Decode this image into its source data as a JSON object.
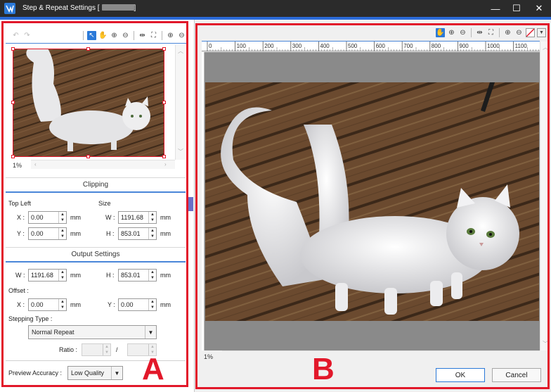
{
  "window": {
    "title": "Step & Repeat Settings",
    "title_suffix_open": " [",
    "title_suffix_close": "]",
    "minimize": "—",
    "maximize": "☐",
    "close": "✕"
  },
  "left_toolbar": {
    "icons": [
      "undo-icon",
      "redo-icon",
      "select-arrow-icon",
      "hand-icon",
      "zoom-in-icon",
      "zoom-out-icon",
      "fit-width-icon",
      "fit-page-icon",
      "plus-circle-icon",
      "minus-circle-icon"
    ]
  },
  "thumbnail": {
    "zoom": "1%"
  },
  "clipping": {
    "header": "Clipping",
    "top_left_label": "Top Left",
    "size_label": "Size",
    "x_label": "X :",
    "x_value": "0.00",
    "y_label": "Y :",
    "y_value": "0.00",
    "w_label": "W :",
    "w_value": "1191.68",
    "h_label": "H :",
    "h_value": "853.01",
    "unit": "mm"
  },
  "output": {
    "header": "Output Settings",
    "w_label": "W :",
    "w_value": "1191.68",
    "h_label": "H :",
    "h_value": "853.01",
    "unit": "mm",
    "offset_label": "Offset :",
    "offset_x_label": "X :",
    "offset_x_value": "0.00",
    "offset_y_label": "Y :",
    "offset_y_value": "0.00",
    "stepping_label": "Stepping Type :",
    "stepping_value": "Normal Repeat",
    "ratio_label": "Ratio :",
    "ratio_sep": "/"
  },
  "preview": {
    "accuracy_label": "Preview Accuracy :",
    "accuracy_value": "Low Quality"
  },
  "right_toolbar": {
    "icons": [
      "hand-icon",
      "zoom-in-icon",
      "zoom-out-icon",
      "fit-width-icon",
      "fit-page-icon",
      "plus-circle-icon",
      "minus-circle-icon",
      "no-color-swatch-icon",
      "dropdown-icon"
    ]
  },
  "ruler": {
    "ticks": [
      "0",
      "100",
      "200",
      "300",
      "400",
      "500",
      "600",
      "700",
      "800",
      "900",
      "1000",
      "1100"
    ]
  },
  "main_view": {
    "zoom": "1%"
  },
  "buttons": {
    "ok": "OK",
    "cancel": "Cancel"
  },
  "annotations": {
    "a": "A",
    "b": "B"
  },
  "colors": {
    "accent": "#2b79d8",
    "annotation_red": "#e2182a",
    "titlebar": "#2b2b2b",
    "floor": "#6b4a2f"
  }
}
